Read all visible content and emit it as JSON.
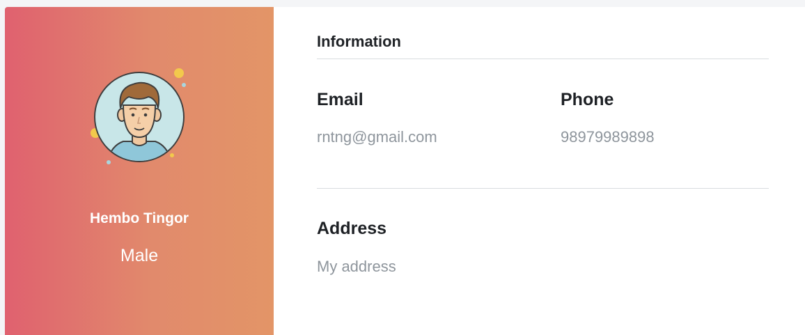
{
  "profile": {
    "name": "Hembo Tingor",
    "gender": "Male",
    "avatar_icon": "user-avatar-icon",
    "gradient_start": "#e0616f",
    "gradient_end": "#e39567"
  },
  "information": {
    "title": "Information",
    "email_label": "Email",
    "email_value": "rntng@gmail.com",
    "phone_label": "Phone",
    "phone_value": "98979989898",
    "address_label": "Address",
    "address_value": "My address"
  }
}
